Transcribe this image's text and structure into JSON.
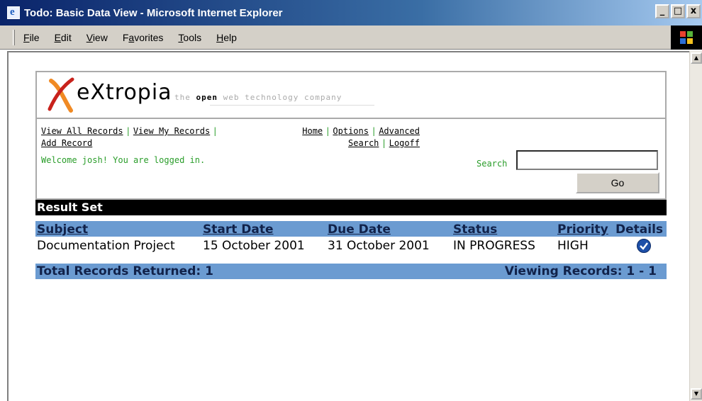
{
  "window": {
    "title": "Todo: Basic Data View - Microsoft Internet Explorer",
    "buttons": [
      "_",
      "□",
      "x"
    ]
  },
  "menu": [
    {
      "label": "File",
      "key": "F",
      "rest": "ile"
    },
    {
      "label": "Edit",
      "key": "E",
      "rest": "dit"
    },
    {
      "label": "View",
      "key": "V",
      "rest": "iew"
    },
    {
      "label": "Favorites",
      "key": "a",
      "pre": "F",
      "rest": "vorites"
    },
    {
      "label": "Tools",
      "key": "T",
      "rest": "ools"
    },
    {
      "label": "Help",
      "key": "H",
      "rest": "elp"
    }
  ],
  "brand": {
    "name": "eXtropia",
    "tagline_pre": "the ",
    "tagline_bold": "open",
    "tagline_post": " web technology company",
    "colors": {
      "accent_green": "#2a9d2a",
      "header_blue": "#6b9bd1",
      "logo_orange": "#f08a24",
      "logo_red": "#c8221c"
    }
  },
  "nav": {
    "view_all": "View All Records",
    "view_my": "View My Records",
    "add": "Add Record",
    "home": "Home",
    "options": "Options",
    "advanced": "Advanced",
    "search": "Search",
    "logoff": "Logoff",
    "separator": "|"
  },
  "welcome": "Welcome josh! You are logged in.",
  "search": {
    "label": "Search",
    "value": "",
    "button": "Go"
  },
  "result": {
    "title": "Result Set",
    "columns": [
      "Subject",
      "Start Date",
      "Due Date",
      "Status",
      "Priority",
      "Details"
    ],
    "rows": [
      {
        "subject": "Documentation Project",
        "start": "15 October 2001",
        "due": "31 October 2001",
        "status": "IN PROGRESS",
        "priority": "HIGH",
        "details_icon": "check-circle-icon"
      }
    ],
    "total": "Total Records Returned: 1",
    "viewing": "Viewing Records: 1 - 1"
  }
}
